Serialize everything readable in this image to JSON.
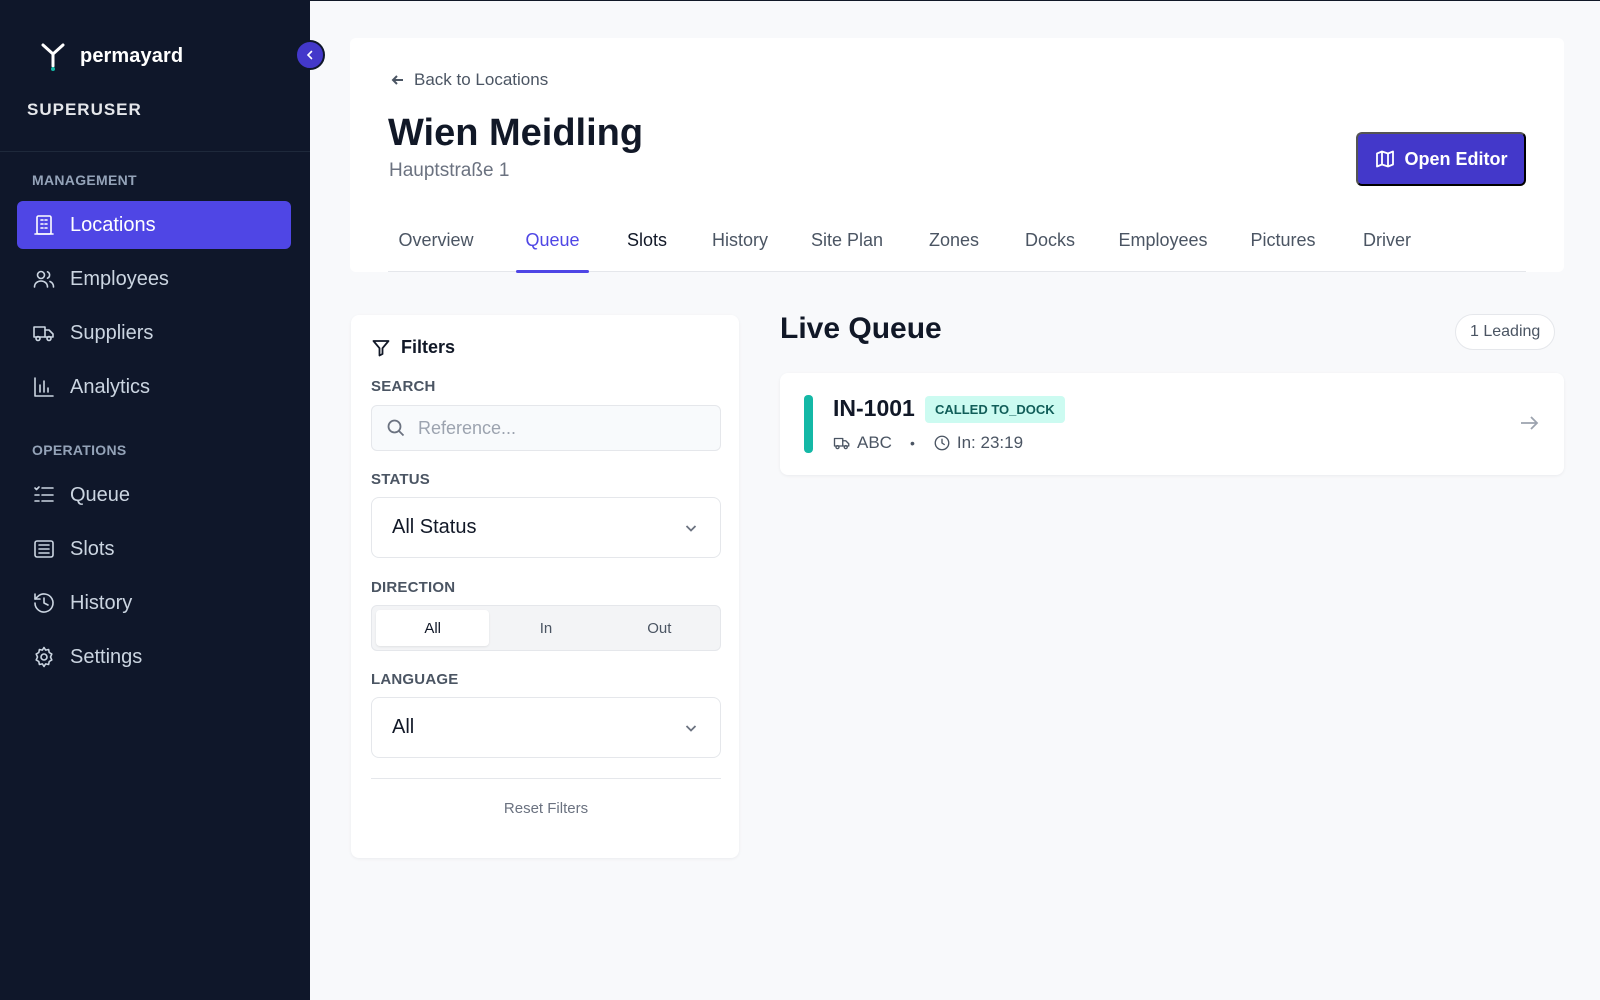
{
  "brand": {
    "name": "permayard",
    "role": "SUPERUSER"
  },
  "sidebar": {
    "management_label": "MANAGEMENT",
    "operations_label": "OPERATIONS",
    "management": [
      {
        "label": "Locations",
        "icon": "building-icon",
        "active": true
      },
      {
        "label": "Employees",
        "icon": "users-icon"
      },
      {
        "label": "Suppliers",
        "icon": "truck-icon"
      },
      {
        "label": "Analytics",
        "icon": "bar-chart-icon"
      }
    ],
    "operations": [
      {
        "label": "Queue",
        "icon": "list-icon"
      },
      {
        "label": "Slots",
        "icon": "database-icon"
      },
      {
        "label": "History",
        "icon": "history-icon"
      },
      {
        "label": "Settings",
        "icon": "gear-icon"
      }
    ]
  },
  "header": {
    "back_label": "Back to Locations",
    "title": "Wien Meidling",
    "subtitle": "Hauptstraße 1",
    "open_editor_label": "Open Editor",
    "tabs": [
      "Overview",
      "Queue",
      "Slots",
      "History",
      "Site Plan",
      "Zones",
      "Docks",
      "Employees",
      "Pictures",
      "Driver"
    ],
    "active_tab": "Queue"
  },
  "filters": {
    "title": "Filters",
    "search_label": "SEARCH",
    "search_placeholder": "Reference...",
    "search_value": "",
    "status_label": "STATUS",
    "status_value": "All Status",
    "direction_label": "DIRECTION",
    "direction_options": [
      "All",
      "In",
      "Out"
    ],
    "direction_selected": "All",
    "language_label": "LANGUAGE",
    "language_value": "All",
    "reset_label": "Reset Filters"
  },
  "queue": {
    "title": "Live Queue",
    "leading_badge": "1 Leading",
    "items": [
      {
        "reference": "IN-1001",
        "status": "CALLED TO_DOCK",
        "supplier": "ABC",
        "time": "In: 23:19",
        "accent": "#14b8a6"
      }
    ]
  },
  "colors": {
    "sidebar_bg": "#0f172a",
    "accent": "#4f46e5",
    "button": "#4338ca",
    "status_bg": "#ccfbf1",
    "status_text": "#115e59"
  }
}
